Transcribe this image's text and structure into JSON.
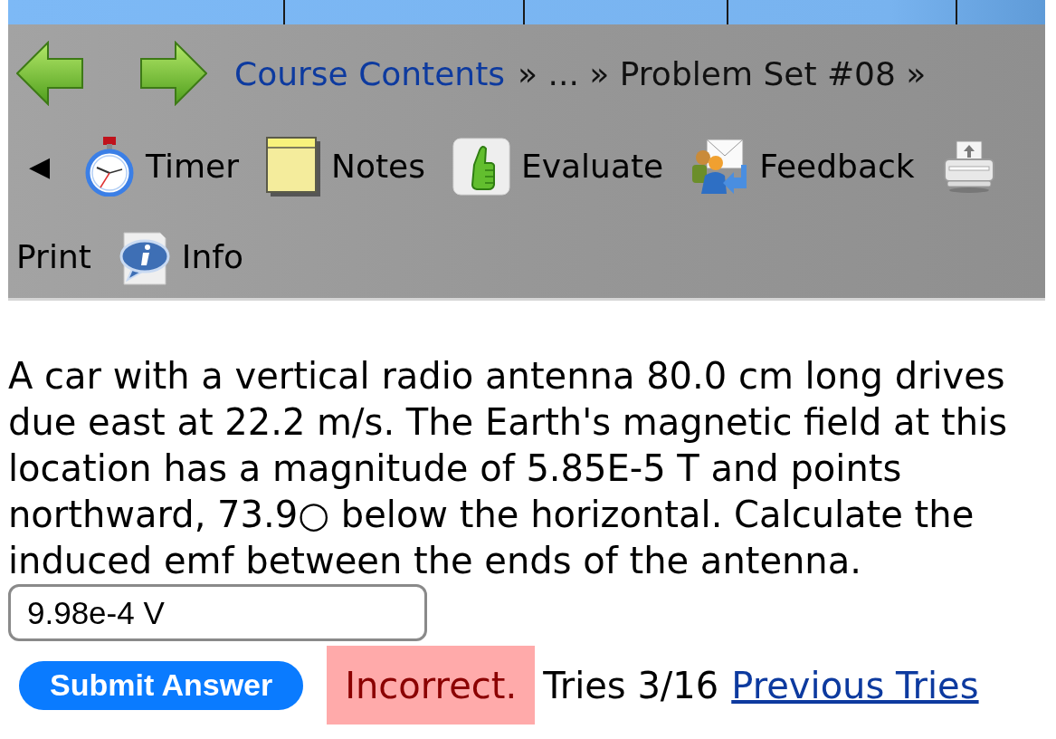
{
  "breadcrumb": [
    {
      "kind": "link",
      "label": "Course Contents"
    },
    {
      "kind": "text",
      "label": "» ... » Problem Set #08 »"
    }
  ],
  "toolbar": {
    "toggle": "◀",
    "items": [
      {
        "kind": "timer",
        "label": "Timer"
      },
      {
        "kind": "notes",
        "label": "Notes"
      },
      {
        "kind": "evaluate",
        "label": "Evaluate"
      },
      {
        "kind": "feedback",
        "label": "Feedback"
      },
      {
        "kind": "print",
        "label": "Print"
      },
      {
        "kind": "info",
        "label": "Info"
      }
    ]
  },
  "problem": {
    "text": "A car with a vertical radio antenna 80.0 cm long drives due east at 22.2 m/s. The Earth's magnetic field at this location has a magnitude of 5.85E-5 T and points northward, 73.9○ below the horizontal. Calculate the induced emf between the ends of the antenna.",
    "answer": "9.98e-4 V",
    "submit": "Submit Answer",
    "result": {
      "kind": "incorrect",
      "text": "Incorrect."
    },
    "tries": "Tries 3/16",
    "previous_tries": "Previous Tries"
  }
}
